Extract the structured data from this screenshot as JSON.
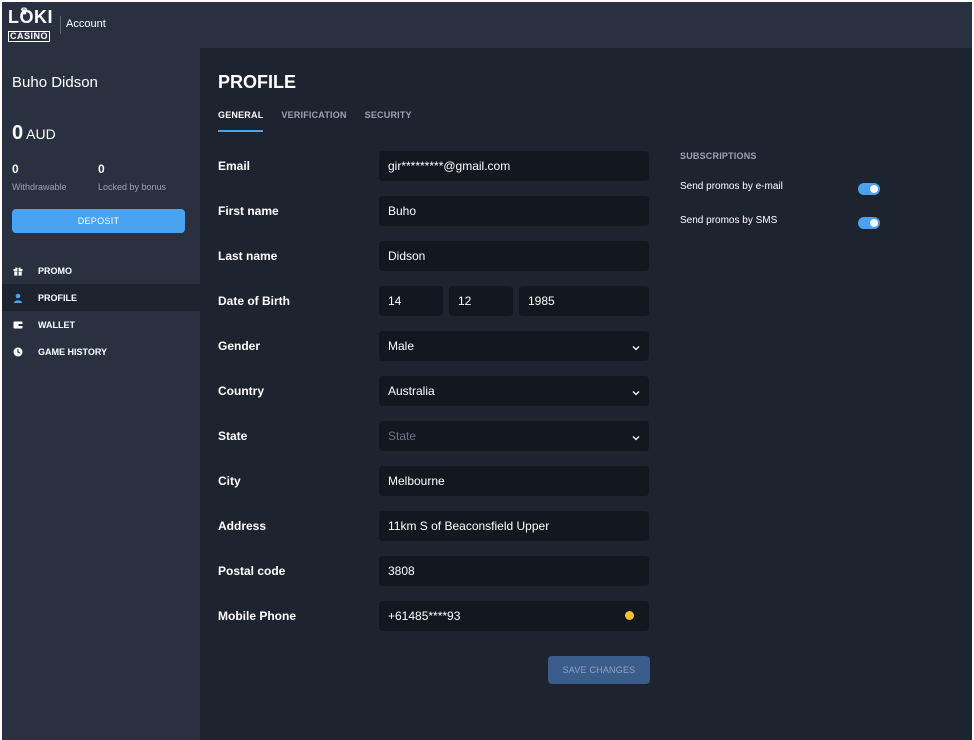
{
  "header": {
    "logo_text": "LOKI",
    "logo_subtext": "CASINO",
    "title": "Account"
  },
  "sidebar": {
    "user_name": "Buho Didson",
    "balance_value": "0",
    "balance_currency": "AUD",
    "withdrawable_value": "0",
    "withdrawable_label": "Withdrawable",
    "locked_value": "0",
    "locked_label": "Locked by bonus",
    "deposit_label": "DEPOSIT",
    "nav": [
      {
        "label": "PROMO",
        "icon": "gift-icon"
      },
      {
        "label": "PROFILE",
        "icon": "user-icon",
        "active": true
      },
      {
        "label": "WALLET",
        "icon": "wallet-icon"
      },
      {
        "label": "GAME HISTORY",
        "icon": "clock-icon"
      }
    ]
  },
  "main": {
    "title": "PROFILE",
    "tabs": [
      {
        "label": "GENERAL",
        "active": true
      },
      {
        "label": "VERIFICATION"
      },
      {
        "label": "SECURITY"
      }
    ]
  },
  "form": {
    "email_label": "Email",
    "email_value": "gir*********@gmail.com",
    "first_name_label": "First name",
    "first_name_value": "Buho",
    "last_name_label": "Last name",
    "last_name_value": "Didson",
    "dob_label": "Date of Birth",
    "dob_day": "14",
    "dob_month": "12",
    "dob_year": "1985",
    "gender_label": "Gender",
    "gender_value": "Male",
    "country_label": "Country",
    "country_value": "Australia",
    "state_label": "State",
    "state_placeholder": "State",
    "city_label": "City",
    "city_value": "Melbourne",
    "address_label": "Address",
    "address_value": "11km S of Beaconsfield Upper",
    "postal_label": "Postal code",
    "postal_value": "3808",
    "phone_label": "Mobile Phone",
    "phone_value": "+61485****93",
    "save_label": "SAVE CHANGES"
  },
  "subscriptions": {
    "title": "SUBSCRIPTIONS",
    "email_label": "Send promos by e-mail",
    "email_on": true,
    "sms_label": "Send promos by SMS",
    "sms_on": true
  },
  "colors": {
    "accent": "#4aa3f0",
    "background": "#1e2330",
    "panel": "#293141",
    "field": "#13171f",
    "warning": "#f2c230"
  }
}
